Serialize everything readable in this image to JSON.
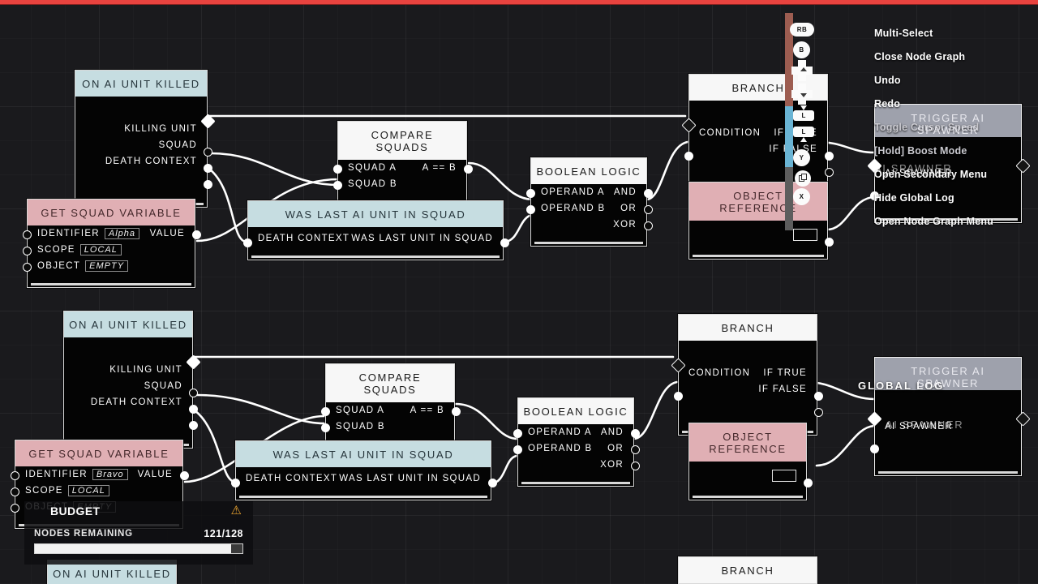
{
  "app": {
    "accent_red": "#e8433f",
    "header_blue": "#c6dde1",
    "header_pink": "#e0afb4",
    "header_white": "#f7f7f7",
    "canvas_bg": "#1a1a1d"
  },
  "budget": {
    "title": "BUDGET",
    "warning_icon": "warning-triangle-icon",
    "subtitle": "NODES REMAINING",
    "count": "121/128",
    "fill_percent": 94.5
  },
  "controls": {
    "items": [
      {
        "label": "Multi-Select",
        "button": "RB",
        "glyph": "rb-bumper-icon"
      },
      {
        "label": "Close Node Graph",
        "button": "B",
        "glyph": "b-button-icon"
      },
      {
        "label": "Undo",
        "button": "",
        "glyph": "dpad-up-icon"
      },
      {
        "label": "Redo",
        "button": "",
        "glyph": "dpad-down-icon"
      },
      {
        "label": "Toggle Cursor Speed",
        "button": "L",
        "glyph": "left-stick-click-icon"
      },
      {
        "label": "[Hold] Boost Mode",
        "button": "L",
        "glyph": "left-stick-hold-icon"
      },
      {
        "label": "Open Secondary Menu",
        "button": "Y",
        "glyph": "y-button-icon"
      },
      {
        "label": "Hide Global Log",
        "button": "",
        "glyph": "copy-window-icon"
      },
      {
        "label": "Open Node Graph Menu",
        "button": "X",
        "glyph": "x-button-icon"
      }
    ]
  },
  "overlays": {
    "global_log_label": "GLOBAL LOG",
    "trigger_ghost_top": "TRIGGER AI SPAWNER",
    "ai_spawner_ghost_top": "AI SPAWNER"
  },
  "graph": {
    "nodes": [
      {
        "id": "n1",
        "title": "ON AI UNIT KILLED",
        "style": "blue",
        "rows": [
          {
            "left": "",
            "right": ""
          },
          {
            "left": "",
            "right": "KILLING UNIT"
          },
          {
            "left": "",
            "right": "SQUAD"
          },
          {
            "left": "",
            "right": "DEATH CONTEXT"
          }
        ]
      },
      {
        "id": "n2",
        "title": "GET SQUAD VARIABLE",
        "style": "pink",
        "rows": [
          {
            "left": "IDENTIFIER",
            "value": "Alpha",
            "right": "VALUE"
          },
          {
            "left": "SCOPE",
            "value": "LOCAL",
            "right": ""
          },
          {
            "left": "OBJECT",
            "value": "EMPTY",
            "right": ""
          }
        ]
      },
      {
        "id": "n3",
        "title": "COMPARE SQUADS",
        "style": "white",
        "rows": [
          {
            "left": "SQUAD A",
            "right": "A == B"
          },
          {
            "left": "SQUAD B",
            "right": ""
          }
        ]
      },
      {
        "id": "n4",
        "title": "WAS LAST AI UNIT IN SQUAD",
        "style": "blue",
        "rows": [
          {
            "left": "DEATH CONTEXT",
            "right": "WAS LAST UNIT IN SQUAD"
          }
        ]
      },
      {
        "id": "n5",
        "title": "BOOLEAN LOGIC",
        "style": "white",
        "rows": [
          {
            "left": "OPERAND A",
            "right": "AND"
          },
          {
            "left": "OPERAND B",
            "right": "OR"
          },
          {
            "left": "",
            "right": "XOR"
          }
        ]
      },
      {
        "id": "n6",
        "title": "BRANCH",
        "style": "white",
        "rows": [
          {
            "left": "",
            "right": ""
          },
          {
            "left": "CONDITION",
            "right": "IF TRUE"
          },
          {
            "left": "",
            "right": "IF FALSE"
          }
        ]
      },
      {
        "id": "n7",
        "title": "OBJECT REFERENCE",
        "style": "pink",
        "rows": [
          {
            "left": "",
            "right": "swatch"
          }
        ]
      },
      {
        "id": "n8",
        "title": "TRIGGER AI SPAWNER",
        "style": "selected",
        "rows": [
          {
            "left": "",
            "right": ""
          },
          {
            "left": "AI SPAWNER",
            "right": ""
          }
        ]
      },
      {
        "id": "n9",
        "title": "ON AI UNIT KILLED",
        "style": "blue",
        "rows": [
          {
            "left": "",
            "right": ""
          },
          {
            "left": "",
            "right": "KILLING UNIT"
          },
          {
            "left": "",
            "right": "SQUAD"
          },
          {
            "left": "",
            "right": "DEATH CONTEXT"
          }
        ]
      },
      {
        "id": "n10",
        "title": "GET SQUAD VARIABLE",
        "style": "pink",
        "rows": [
          {
            "left": "IDENTIFIER",
            "value": "Bravo",
            "right": "VALUE"
          },
          {
            "left": "SCOPE",
            "value": "LOCAL",
            "right": ""
          },
          {
            "left": "OBJECT",
            "value": "EMPTY",
            "right": ""
          }
        ]
      },
      {
        "id": "n11",
        "title": "COMPARE SQUADS",
        "style": "white",
        "rows": [
          {
            "left": "SQUAD A",
            "right": "A == B"
          },
          {
            "left": "SQUAD B",
            "right": ""
          }
        ]
      },
      {
        "id": "n12",
        "title": "WAS LAST AI UNIT IN SQUAD",
        "style": "blue",
        "rows": [
          {
            "left": "DEATH CONTEXT",
            "right": "WAS LAST UNIT IN SQUAD"
          }
        ]
      },
      {
        "id": "n13",
        "title": "BOOLEAN LOGIC",
        "style": "white",
        "rows": [
          {
            "left": "OPERAND A",
            "right": "AND"
          },
          {
            "left": "OPERAND B",
            "right": "OR"
          },
          {
            "left": "",
            "right": "XOR"
          }
        ]
      },
      {
        "id": "n14",
        "title": "BRANCH",
        "style": "white",
        "rows": [
          {
            "left": "",
            "right": ""
          },
          {
            "left": "CONDITION",
            "right": "IF TRUE"
          },
          {
            "left": "",
            "right": "IF FALSE"
          }
        ]
      },
      {
        "id": "n15",
        "title": "OBJECT REFERENCE",
        "style": "pink",
        "rows": [
          {
            "left": "",
            "right": "swatch"
          }
        ]
      },
      {
        "id": "n16",
        "title": "TRIGGER AI SPAWNER",
        "style": "selected",
        "rows": [
          {
            "left": "",
            "right": ""
          },
          {
            "left": "AI SPAWNER",
            "right": ""
          }
        ]
      },
      {
        "id": "n17",
        "title": "ON AI UNIT KILLED",
        "style": "blue",
        "rows": []
      },
      {
        "id": "n18",
        "title": "BRANCH",
        "style": "white",
        "rows": []
      }
    ]
  }
}
